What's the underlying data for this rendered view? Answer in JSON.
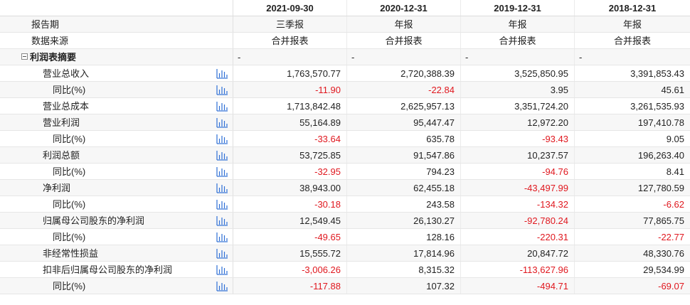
{
  "periods": [
    "2021-09-30",
    "2020-12-31",
    "2019-12-31",
    "2018-12-31"
  ],
  "meta_rows": [
    {
      "label": "报告期",
      "values": [
        "三季报",
        "年报",
        "年报",
        "年报"
      ]
    },
    {
      "label": "数据来源",
      "values": [
        "合并报表",
        "合并报表",
        "合并报表",
        "合并报表"
      ]
    }
  ],
  "section": {
    "label": "利润表摘要",
    "values": [
      "-",
      "-",
      "-",
      "-"
    ]
  },
  "rows": [
    {
      "label": "营业总收入",
      "level": 0,
      "values": [
        "1,763,570.77",
        "2,720,388.39",
        "3,525,850.95",
        "3,391,853.43"
      ]
    },
    {
      "label": "同比(%)",
      "level": 1,
      "values": [
        "-11.90",
        "-22.84",
        "3.95",
        "45.61"
      ]
    },
    {
      "label": "营业总成本",
      "level": 0,
      "values": [
        "1,713,842.48",
        "2,625,957.13",
        "3,351,724.20",
        "3,261,535.93"
      ]
    },
    {
      "label": "营业利润",
      "level": 0,
      "values": [
        "55,164.89",
        "95,447.47",
        "12,972.20",
        "197,410.78"
      ]
    },
    {
      "label": "同比(%)",
      "level": 1,
      "values": [
        "-33.64",
        "635.78",
        "-93.43",
        "9.05"
      ]
    },
    {
      "label": "利润总额",
      "level": 0,
      "values": [
        "53,725.85",
        "91,547.86",
        "10,237.57",
        "196,263.40"
      ]
    },
    {
      "label": "同比(%)",
      "level": 1,
      "values": [
        "-32.95",
        "794.23",
        "-94.76",
        "8.41"
      ]
    },
    {
      "label": "净利润",
      "level": 0,
      "values": [
        "38,943.00",
        "62,455.18",
        "-43,497.99",
        "127,780.59"
      ]
    },
    {
      "label": "同比(%)",
      "level": 1,
      "values": [
        "-30.18",
        "243.58",
        "-134.32",
        "-6.62"
      ]
    },
    {
      "label": "归属母公司股东的净利润",
      "level": 0,
      "values": [
        "12,549.45",
        "26,130.27",
        "-92,780.24",
        "77,865.75"
      ]
    },
    {
      "label": "同比(%)",
      "level": 1,
      "values": [
        "-49.65",
        "128.16",
        "-220.31",
        "-22.77"
      ]
    },
    {
      "label": "非经常性损益",
      "level": 0,
      "values": [
        "15,555.72",
        "17,814.96",
        "20,847.72",
        "48,330.76"
      ]
    },
    {
      "label": "扣非后归属母公司股东的净利润",
      "level": 0,
      "values": [
        "-3,006.26",
        "8,315.32",
        "-113,627.96",
        "29,534.99"
      ]
    },
    {
      "label": "同比(%)",
      "level": 1,
      "values": [
        "-117.88",
        "107.32",
        "-494.71",
        "-69.07"
      ]
    }
  ],
  "colors": {
    "negative": "#e0171e",
    "icon": "#2f6fd6"
  },
  "icons": {
    "row_chart": "bar-chart-icon",
    "collapse": "collapse-minus-icon"
  }
}
